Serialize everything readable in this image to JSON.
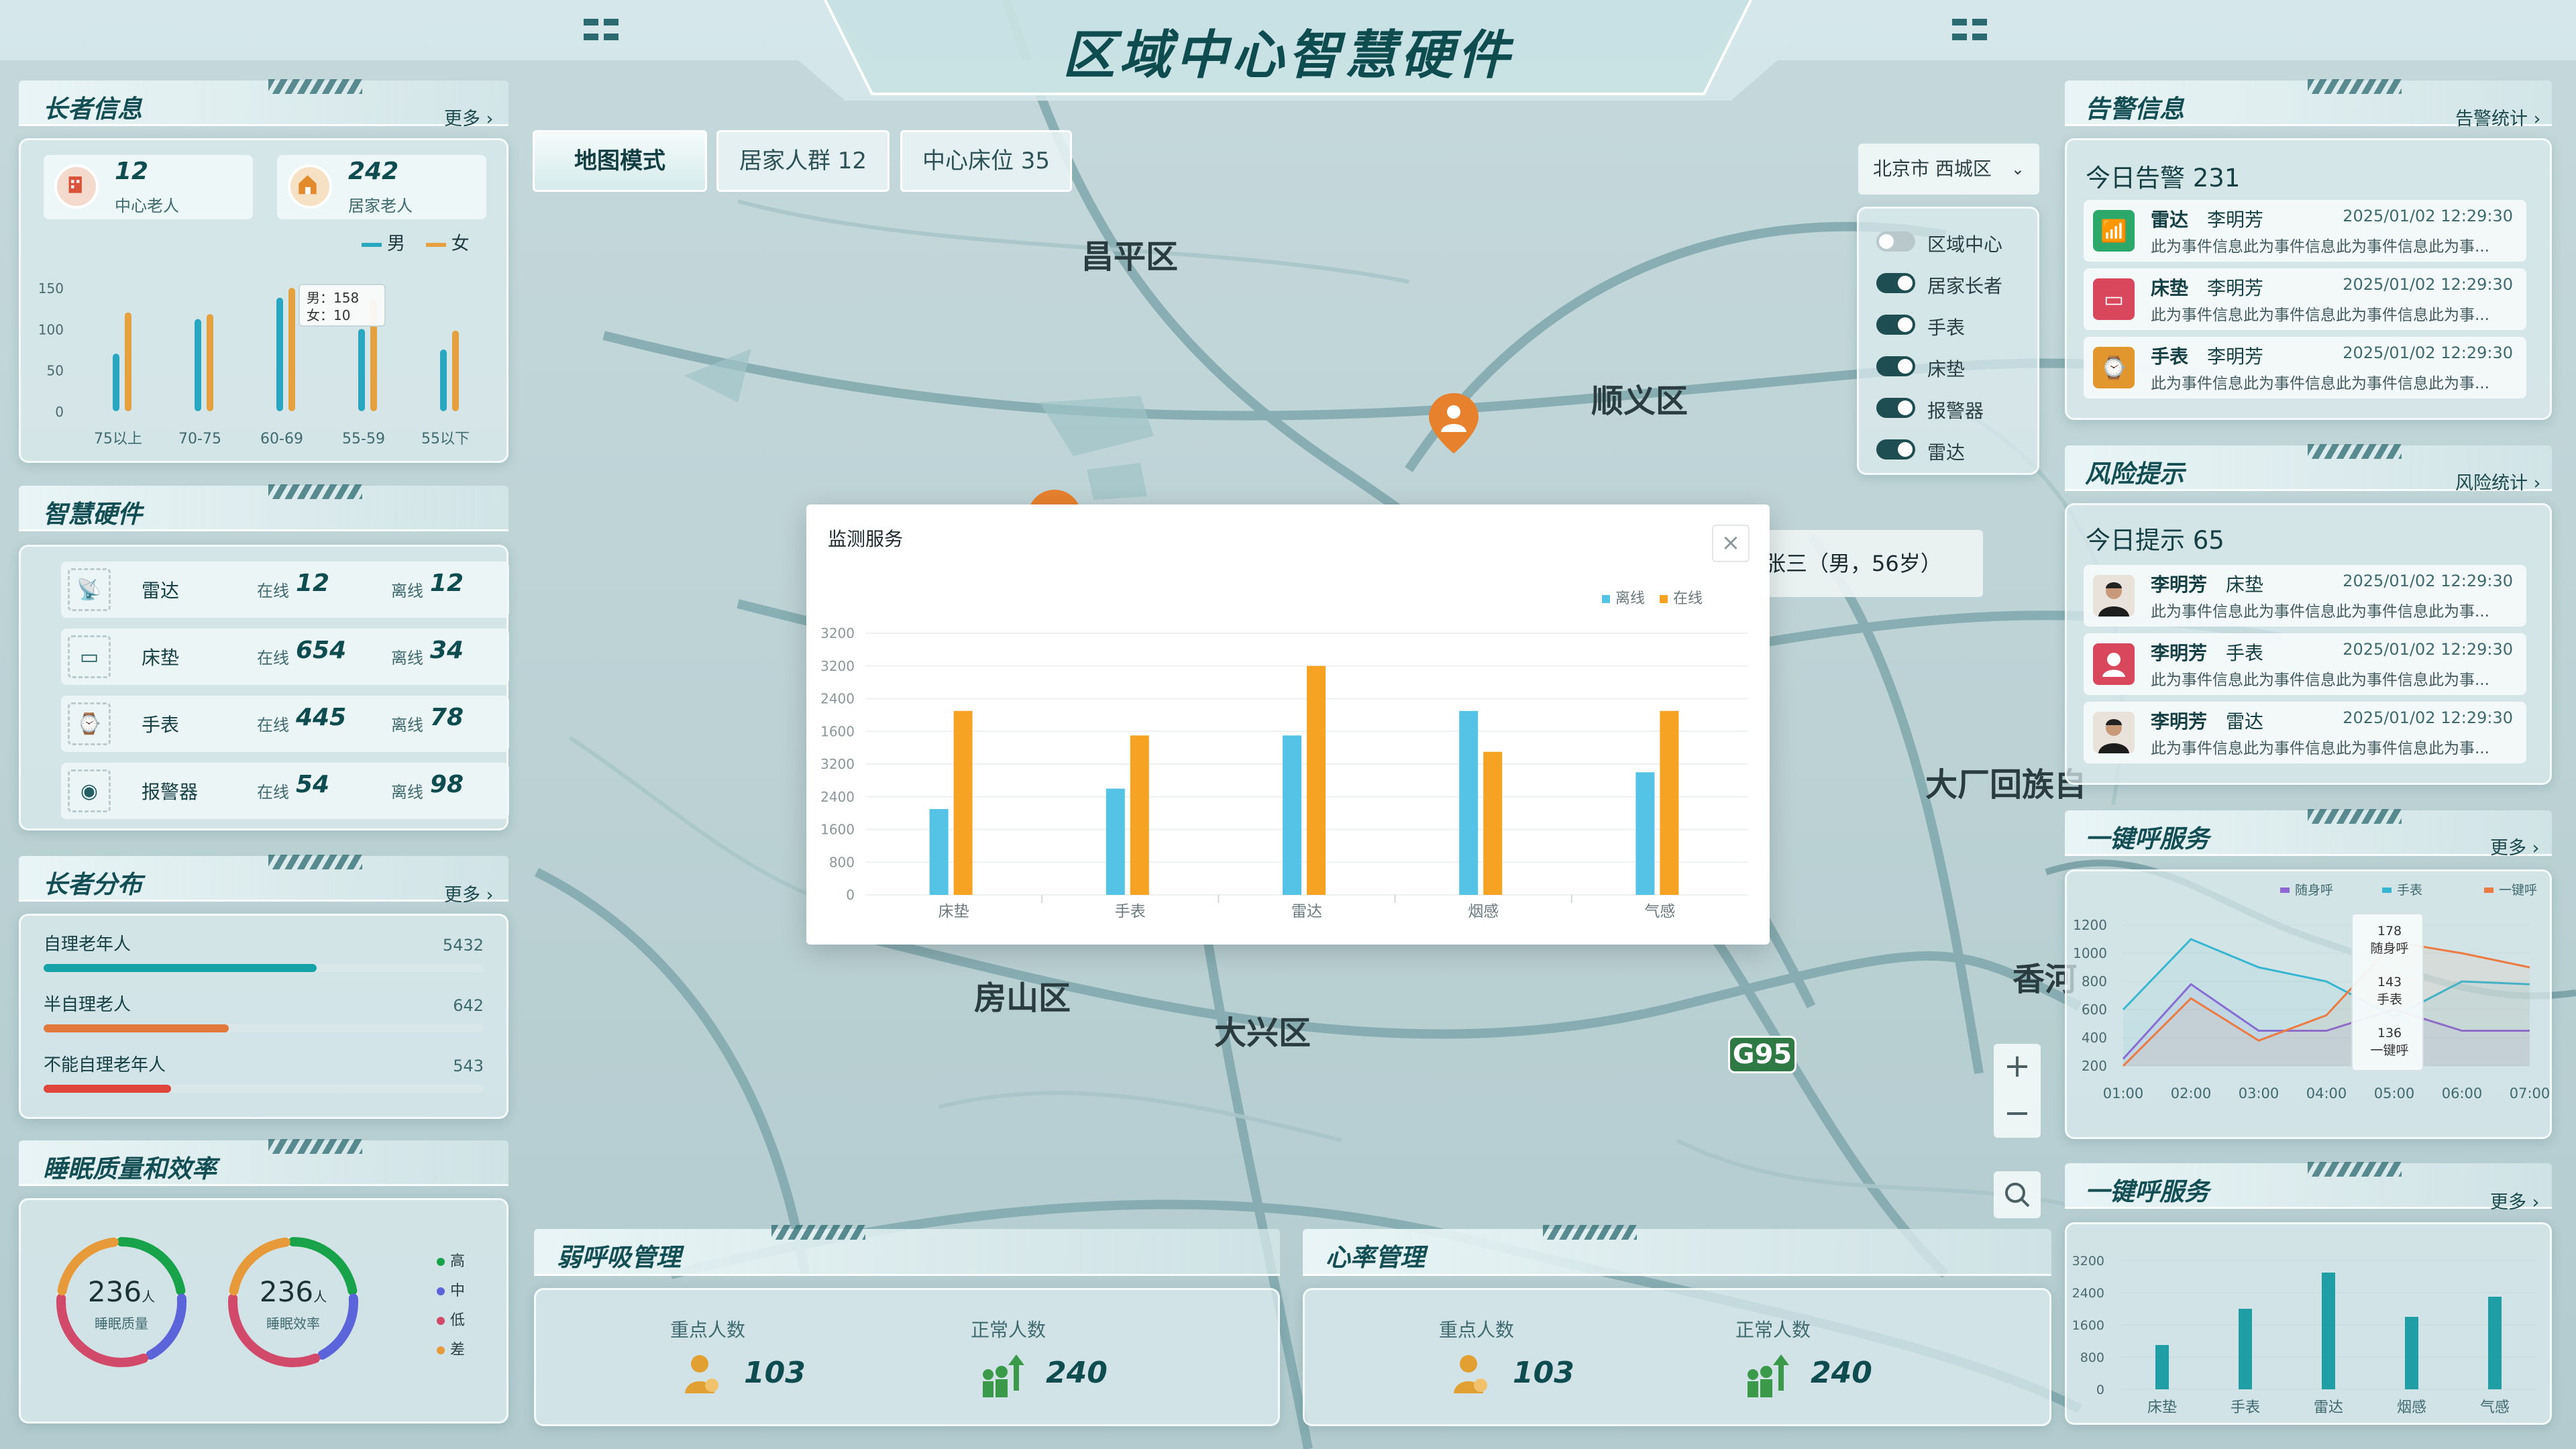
{
  "header": {
    "title": "区域中心智慧硬件"
  },
  "tabs": [
    {
      "label": "地图模式",
      "active": true
    },
    {
      "label": "居家人群 12",
      "active": false
    },
    {
      "label": "中心床位 35",
      "active": false
    }
  ],
  "region_select": {
    "value": "北京市 西城区"
  },
  "layer_toggles": [
    {
      "label": "区域中心",
      "on": false
    },
    {
      "label": "居家长者",
      "on": true
    },
    {
      "label": "手表",
      "on": true
    },
    {
      "label": "床垫",
      "on": true
    },
    {
      "label": "报警器",
      "on": true
    },
    {
      "label": "雷达",
      "on": true
    }
  ],
  "map": {
    "labels": [
      "昌平区",
      "顺义区",
      "房山区",
      "大兴区",
      "大厂回族自",
      "香河",
      "G95"
    ],
    "popup": "张三（男，56岁）"
  },
  "elder_info": {
    "title": "长者信息",
    "more": "更多",
    "center": {
      "count": "12",
      "label": "中心老人"
    },
    "home": {
      "count": "242",
      "label": "居家老人"
    },
    "legend": [
      "男",
      "女"
    ],
    "tooltip": {
      "male": "男：158",
      "female": "女：10"
    },
    "chart_data": {
      "type": "bar",
      "categories": [
        "75以上",
        "70-75",
        "60-69",
        "55-59",
        "55以下"
      ],
      "ylim": [
        0,
        150
      ],
      "yticks": [
        "150",
        "100",
        "50",
        "0"
      ],
      "series": [
        {
          "name": "男",
          "values": [
            70,
            112,
            138,
            100,
            75
          ],
          "color": "#2aa7c0"
        },
        {
          "name": "女",
          "values": [
            120,
            118,
            150,
            135,
            98
          ],
          "color": "#e5a040"
        }
      ]
    }
  },
  "hardware": {
    "title": "智慧硬件",
    "online_label": "在线",
    "offline_label": "离线",
    "items": [
      {
        "name": "雷达",
        "online": "12",
        "offline": "12",
        "icon": "radar-icon"
      },
      {
        "name": "床垫",
        "online": "654",
        "offline": "34",
        "icon": "mattress-icon"
      },
      {
        "name": "手表",
        "online": "445",
        "offline": "78",
        "icon": "watch-icon"
      },
      {
        "name": "报警器",
        "online": "54",
        "offline": "98",
        "icon": "alarm-icon"
      }
    ]
  },
  "distribution": {
    "title": "长者分布",
    "more": "更多",
    "items": [
      {
        "label": "自理老年人",
        "value": "5432",
        "fraction": 0.62,
        "color": "#15a3a7"
      },
      {
        "label": "半自理老人",
        "value": "642",
        "fraction": 0.42,
        "color": "#e2783a"
      },
      {
        "label": "不能自理老年人",
        "value": "543",
        "fraction": 0.29,
        "color": "#e0453c"
      }
    ]
  },
  "sleep": {
    "title": "睡眠质量和效率",
    "gauges": [
      {
        "value": "236",
        "unit": "人",
        "label": "睡眠质量"
      },
      {
        "value": "236",
        "unit": "人",
        "label": "睡眠效率"
      }
    ],
    "legend": [
      {
        "label": "高",
        "color": "#18a34a"
      },
      {
        "label": "中",
        "color": "#5b64d8"
      },
      {
        "label": "低",
        "color": "#d14a6a"
      },
      {
        "label": "差",
        "color": "#e69a3a"
      }
    ]
  },
  "breathing": {
    "title": "弱呼吸管理",
    "key_label": "重点人数",
    "key_value": "103",
    "normal_label": "正常人数",
    "normal_value": "240"
  },
  "heart": {
    "title": "心率管理",
    "key_label": "重点人数",
    "key_value": "103",
    "normal_label": "正常人数",
    "normal_value": "240"
  },
  "alerts": {
    "title": "告警信息",
    "stat_link": "告警统计",
    "today": "今日告警 231",
    "items": [
      {
        "device": "雷达",
        "name": "李明芳",
        "time": "2025/01/02 12:29:30",
        "desc": "此为事件信息此为事件信息此为事件信息此为事...",
        "color": "#2ca86a",
        "icon": "radar-icon"
      },
      {
        "device": "床垫",
        "name": "李明芳",
        "time": "2025/01/02 12:29:30",
        "desc": "此为事件信息此为事件信息此为事件信息此为事...",
        "color": "#d9475c",
        "icon": "mattress-icon"
      },
      {
        "device": "手表",
        "name": "李明芳",
        "time": "2025/01/02 12:29:30",
        "desc": "此为事件信息此为事件信息此为事件信息此为事...",
        "color": "#e1962e",
        "icon": "watch-icon"
      }
    ]
  },
  "risks": {
    "title": "风险提示",
    "stat_link": "风险统计",
    "today": "今日提示 65",
    "items": [
      {
        "name": "李明芳",
        "device": "床垫",
        "time": "2025/01/02 12:29:30",
        "desc": "此为事件信息此为事件信息此为事件信息此为事...",
        "avatar": "person"
      },
      {
        "name": "李明芳",
        "device": "手表",
        "time": "2025/01/02 12:29:30",
        "desc": "此为事件信息此为事件信息此为事件信息此为事...",
        "avatar": "placeholder"
      },
      {
        "name": "李明芳",
        "device": "雷达",
        "time": "2025/01/02 12:29:30",
        "desc": "此为事件信息此为事件信息此为事件信息此为事...",
        "avatar": "person"
      }
    ]
  },
  "call_service_line": {
    "title": "一键呼服务",
    "more": "更多",
    "tooltip": [
      {
        "value": "178",
        "label": "随身呼"
      },
      {
        "value": "143",
        "label": "手表"
      },
      {
        "value": "136",
        "label": "一键呼"
      }
    ],
    "chart_data": {
      "type": "line",
      "x": [
        "01:00",
        "02:00",
        "03:00",
        "04:00",
        "05:00",
        "06:00",
        "07:00"
      ],
      "yticks": [
        "1200",
        "1000",
        "800",
        "600",
        "400",
        "200"
      ],
      "ylim": [
        200,
        1200
      ],
      "series": [
        {
          "name": "随身呼",
          "color": "#8f67d3",
          "values": [
            250,
            780,
            450,
            450,
            600,
            450,
            450
          ]
        },
        {
          "name": "手表",
          "color": "#37b6d1",
          "values": [
            600,
            1100,
            900,
            800,
            550,
            800,
            780
          ]
        },
        {
          "name": "一键呼",
          "color": "#ec7b43",
          "values": [
            200,
            680,
            380,
            560,
            1080,
            1000,
            900
          ]
        }
      ]
    }
  },
  "call_service_bar": {
    "title": "一键呼服务",
    "more": "更多",
    "chart_data": {
      "type": "bar",
      "categories": [
        "床垫",
        "手表",
        "雷达",
        "烟感",
        "气感"
      ],
      "yticks": [
        "3200",
        "2400",
        "1600",
        "800",
        "0"
      ],
      "ylim": [
        0,
        3200
      ],
      "values": [
        1100,
        2000,
        2900,
        1800,
        2300
      ]
    }
  },
  "modal": {
    "title": "监测服务",
    "close": "×",
    "legend": [
      {
        "label": "离线",
        "color": "#54c3e6"
      },
      {
        "label": "在线",
        "color": "#f6a324"
      }
    ],
    "chart_data": {
      "type": "bar",
      "categories": [
        "床垫",
        "手表",
        "雷达",
        "烟感",
        "气感"
      ],
      "yticks": [
        "3200",
        "3200",
        "2400",
        "1600",
        "3200",
        "2400",
        "1600",
        "800",
        "0"
      ],
      "ylim": [
        0,
        3200
      ],
      "series": [
        {
          "name": "离线",
          "values": [
            1050,
            1300,
            1950,
            2250,
            1500
          ],
          "color": "#54c3e6"
        },
        {
          "name": "在线",
          "values": [
            2250,
            1950,
            2800,
            1750,
            2250
          ],
          "color": "#f6a324"
        }
      ]
    }
  }
}
